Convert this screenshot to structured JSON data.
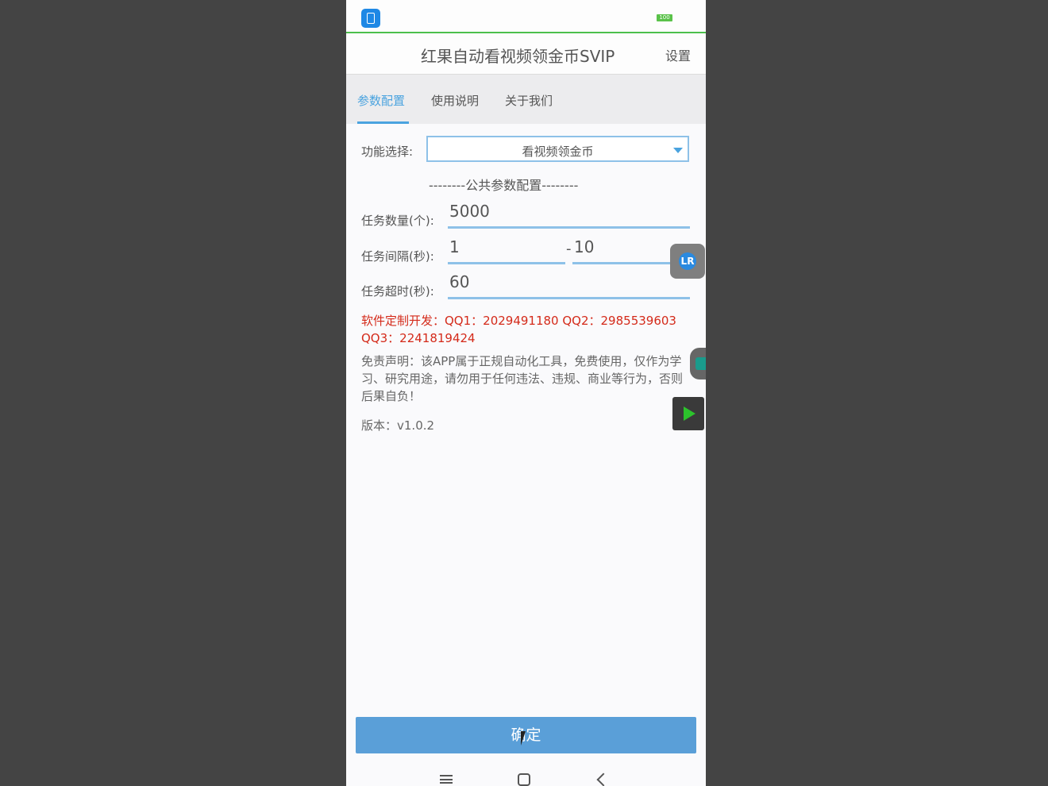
{
  "app": {
    "title": "红果自动看视频领金币SVIP",
    "settings_label": "设置",
    "battery": "100"
  },
  "tabs": [
    {
      "label": "参数配置",
      "active": true
    },
    {
      "label": "使用说明",
      "active": false
    },
    {
      "label": "关于我们",
      "active": false
    }
  ],
  "form": {
    "function_label": "功能选择:",
    "function_value": "看视频领金币",
    "section_title": "--------公共参数配置--------",
    "task_count_label": "任务数量(个):",
    "task_count_value": "5000",
    "interval_label": "任务间隔(秒):",
    "interval_min": "1",
    "interval_dash": "-",
    "interval_max": "10",
    "timeout_label": "任务超时(秒):",
    "timeout_value": "60"
  },
  "info": {
    "developer": "软件定制开发：QQ1：2029491180   QQ2：2985539603   QQ3：2241819424",
    "disclaimer": "免责声明：该APP属于正规自动化工具，免费使用，仅作为学习、研究用途，请勿用于任何违法、违规、商业等行为，否则后果自负！",
    "version": "版本：v1.0.2"
  },
  "confirm_label": "确定",
  "overlay": {
    "lr_badge": "LR"
  },
  "colors": {
    "accent": "#4aa3df",
    "button": "#5a9fd8",
    "warning_text": "#d42a1a",
    "status_line": "#4cc04c"
  }
}
